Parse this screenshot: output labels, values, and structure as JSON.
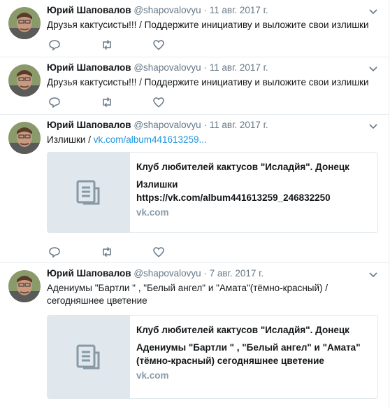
{
  "tweets": [
    {
      "name": "Юрий Шаповалов",
      "handle": "@shapovalovyu",
      "dot": "·",
      "date": "11 авг. 2017 г.",
      "text": "Друзья кактусисты!!! / Поддержите инициативу и выложите свои излишки"
    },
    {
      "name": "Юрий Шаповалов",
      "handle": "@shapovalovyu",
      "dot": "·",
      "date": "11 авг. 2017 г.",
      "text": "Друзья кактусисты!!! / Поддержите инициативу и выложите свои излишки"
    },
    {
      "name": "Юрий Шаповалов",
      "handle": "@shapovalovyu",
      "dot": "·",
      "date": "11 авг. 2017 г.",
      "text_prefix": "Излишки / ",
      "text_link": "vk.com/album441613259...",
      "card": {
        "title": "Клуб любителей кактусов \"Исладйя\". Донецк",
        "description": "Излишки https://vk.com/album441613259_246832250",
        "domain": "vk.com"
      }
    },
    {
      "name": "Юрий Шаповалов",
      "handle": "@shapovalovyu",
      "dot": "·",
      "date": "7 авг. 2017 г.",
      "text": "Адениумы \"Бартли \" , \"Белый ангел\" и \"Амата\"(тёмно-красный) / сегодняшнее цветение",
      "card": {
        "title": "Клуб любителей кактусов \"Исладйя\". Донецк",
        "description": "Адениумы \"Бартли \" , \"Белый ангел\" и \"Амата\" (тёмно-красный) сегодняшнее цветение",
        "domain": "vk.com"
      }
    }
  ],
  "icons": {
    "reply": "reply-icon",
    "retweet": "retweet-icon",
    "like": "heart-icon",
    "menu": "chevron-down-icon",
    "card_placeholder": "document-icon"
  },
  "colors": {
    "link": "#1b95e0",
    "muted": "#657786",
    "border": "#e6ecf0",
    "card_thumb": "#e1e8ed"
  }
}
